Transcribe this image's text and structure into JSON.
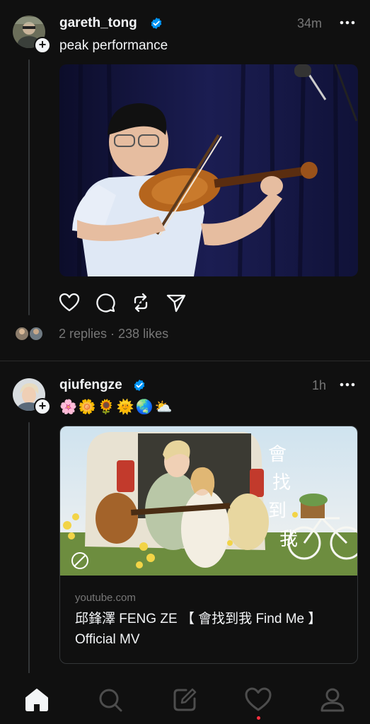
{
  "posts": [
    {
      "username": "gareth_tong",
      "time": "34m",
      "text": "peak performance",
      "replies_likes": "2 replies · 238 likes"
    },
    {
      "username": "qiufengze",
      "time": "1h",
      "emojis": "🌸🌼🌻🌞🌏⛅",
      "link": {
        "domain": "youtube.com",
        "title": "邱鋒澤 FENG ZE 【 會找到我 Find Me 】 Official MV"
      },
      "thumb_text": [
        "會",
        "找",
        "到",
        "我"
      ]
    }
  ],
  "icons": {
    "like": "heart-icon",
    "comment": "comment-icon",
    "repost": "repost-icon",
    "share": "send-icon",
    "more": "more-icon",
    "verified": "verified-badge-icon"
  },
  "colors": {
    "background": "#101010",
    "verified": "#0095f6",
    "notification": "#ff3040"
  }
}
